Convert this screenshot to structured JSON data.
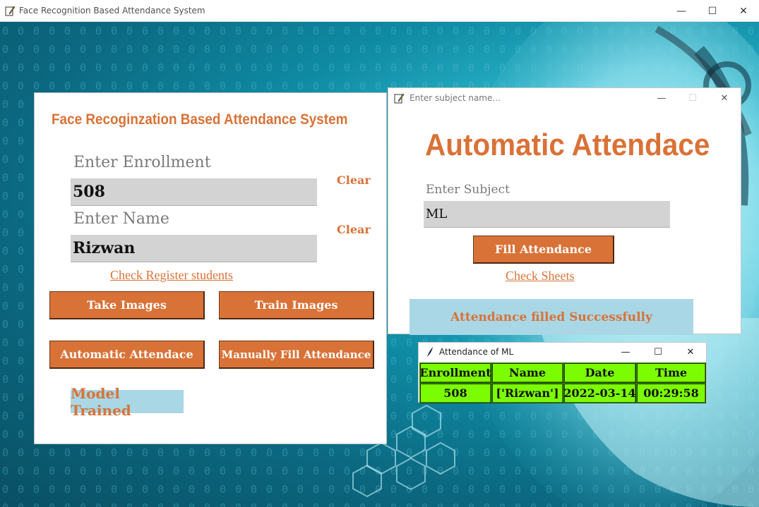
{
  "main_window": {
    "title": "Face Recognition Based Attendance System",
    "controls": {
      "minimize": "—",
      "maximize": "☐",
      "close": "✕"
    }
  },
  "panel": {
    "title": "Face Recoginzation Based Attendance System",
    "enrollment_label": "Enter Enrollment",
    "enrollment_value": "508",
    "name_label": "Enter Name",
    "name_value": "Rizwan",
    "clear_label": "Clear",
    "check_register_link": "Check Register students",
    "buttons": {
      "take_images": "Take Images",
      "train_images": "Train Images",
      "automatic_attendance": "Automatic Attendace",
      "manual_attendance": "Manually Fill Attendance"
    },
    "status": "Model Trained"
  },
  "subject_window": {
    "title": "Enter subject name...",
    "heading": "Automatic Attendace",
    "subject_label": "Enter Subject",
    "subject_value": "ML",
    "fill_button": "Fill Attendance",
    "check_sheets_link": "Check Sheets",
    "status": "Attendance filled Successfully"
  },
  "attendance_window": {
    "title": "Attendance of ML",
    "columns": [
      "Enrollment",
      "Name",
      "Date",
      "Time"
    ],
    "rows": [
      [
        "508",
        "['Rizwan']",
        "2022-03-14",
        "00:29:58"
      ]
    ]
  },
  "colors": {
    "accent": "#d97237",
    "field_bg": "#d3d3d3",
    "status_bg": "#a9d7e6",
    "table_cell": "#7cfc00"
  },
  "icons": {
    "app_icon": "feather-pen-icon",
    "table_icon": "feather-icon"
  }
}
